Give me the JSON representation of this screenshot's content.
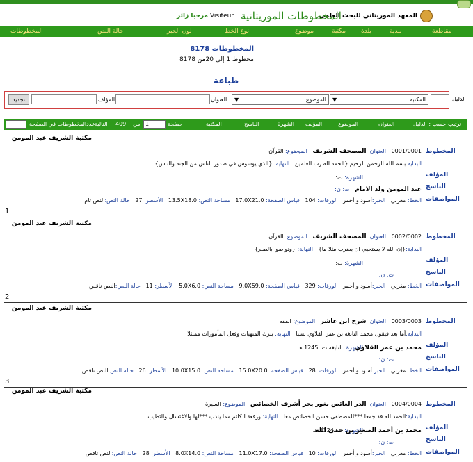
{
  "header": {
    "institute": "المعهد الموريتاني للبحث العلمي",
    "brand": "المخطوطات الموريتانية",
    "welcome_prefix": "مرحبا زائر",
    "visitor": "Visiteur"
  },
  "nav": {
    "items": [
      "مقاطعة",
      "بلدية",
      "بلدة",
      "مكتبة",
      "موضوع",
      "نوع الخط",
      "لون الحبر",
      "حالة النص",
      "المخطوطات"
    ]
  },
  "count": {
    "title": "المخطوطات 8178",
    "subtitle": "مخطوط 1 إلى 20من 8178"
  },
  "print_label": "طباعة",
  "search": {
    "guide_label": "الدليل",
    "library_select": "المكتبة",
    "subject_select": "الموضوع",
    "title_label": "العنوان",
    "author_label": "المؤلف",
    "renew_button": "تجديد"
  },
  "pager": {
    "sort_by": "ترتيب حسب : الدليل",
    "cols": [
      "العنوان",
      "الموضوع",
      "المؤلف",
      "الشهرة",
      "الناسخ",
      "المكتبة"
    ],
    "page_label": "صفحة",
    "page_value": "1",
    "of_label": "من",
    "total_pages": "409",
    "next_label": "التالية",
    "per_page_label": "عددالمخطوطات في الصفحة"
  },
  "labels": {
    "manuscript": "المخطوط",
    "author": "المؤلف",
    "copyist": "الناسخ",
    "specs": "المواصفات",
    "title_k": "العنوان:",
    "subject_k": "الموضوع:",
    "start_k": "البداية:",
    "end_k": "النهاية:",
    "fame_k": "الشهرة:",
    "script_k": "الخط:",
    "ink_k": "الحبر:",
    "papers_k": "الورقات:",
    "page_size_k": "قياس الصفحة:",
    "text_area_k": "مساحة النص:",
    "lines_k": "الأسطر:",
    "state_k": "حالة النص:"
  },
  "records": [
    {
      "library": "مكتبة الشريف عبد المومن",
      "code": "0001/0001",
      "title": "المصحف الشريف",
      "subject": "القرآن",
      "start": "بسم الله الرحمن الرحيم {الحمد لله رب العلمين",
      "end": "{الذي يوسوس في صدور الناس من الجنة والناس}",
      "fame": "ت:",
      "author": "",
      "copyist": "عبد المومن ولد الامام",
      "copyist_date": "ت: ن:",
      "script": "مغربي",
      "ink": "أسود و أحمر",
      "papers": "104",
      "page_size": "17.0X21.0",
      "text_area": "13.5X18.0",
      "lines": "27",
      "state": "النص تام",
      "index": "1"
    },
    {
      "library": "مكتبة الشريف عبد المومن",
      "code": "0002/0002",
      "title": "المصحف الشريف",
      "subject": "القرآن",
      "start": "{إن الله لا يستحيي ان يضرب مثلا ما}",
      "end": "{وتواصوا بالصبر}",
      "fame": "ت:",
      "author": "",
      "copyist": "",
      "copyist_date": "ت: ن:",
      "script": "مغربي",
      "ink": "أسود و أحمر",
      "papers": "329",
      "page_size": "9.0X59.0",
      "text_area": "5.0X6.0",
      "lines": "11",
      "state": "النص ناقص",
      "index": "2"
    },
    {
      "library": "مكتبة الشريف عبد المومن",
      "code": "0003/0003",
      "title": "شرح ابن عاشر",
      "subject": "الفقه",
      "start": "أما بعد فيقول محمد النابغة بن عمر القلاوي نسبا",
      "end": "بترك المنهيات وفعل المأمورات ممتثلا",
      "fame": "النابغة",
      "fame_date": "ت: 1245 هـ",
      "author": "محمد بن عمر القلاوي",
      "copyist": "",
      "copyist_date": "ت: ن:",
      "script": "مغربي",
      "ink": "أسود و أحمر",
      "papers": "28",
      "page_size": "15.0X20.0",
      "text_area": "10.0X15.0",
      "lines": "26",
      "state": "النص ناقص",
      "index": "3"
    },
    {
      "library": "مكتبة الشريف عبد المومن",
      "code": "0004/0004",
      "title": "الدر الغائص بغور بحر أشرف الخصائص",
      "subject": "السيرة",
      "start": "الحمد لله قد جمعا ***للمصطفى حسن الخصائص معا",
      "end": "ورفعة الكاتم مما يندب ***لها والاغتسال والتطيب",
      "fame": "ت: 1324 هـ",
      "author": "محمد بن أحمد الصغير بن حمى الله",
      "copyist": "",
      "copyist_date": "ت: ن:",
      "script": "مغربي",
      "ink": "أسود و أحمر",
      "papers": "10",
      "page_size": "11.0X17.0",
      "text_area": "8.0X14.0",
      "lines": "28",
      "state": "النص ناقص",
      "index": ""
    }
  ],
  "colors": {
    "green": "#2e9a1b",
    "link_blue": "#1c3f9a",
    "nav_text": "#f4e27a"
  }
}
